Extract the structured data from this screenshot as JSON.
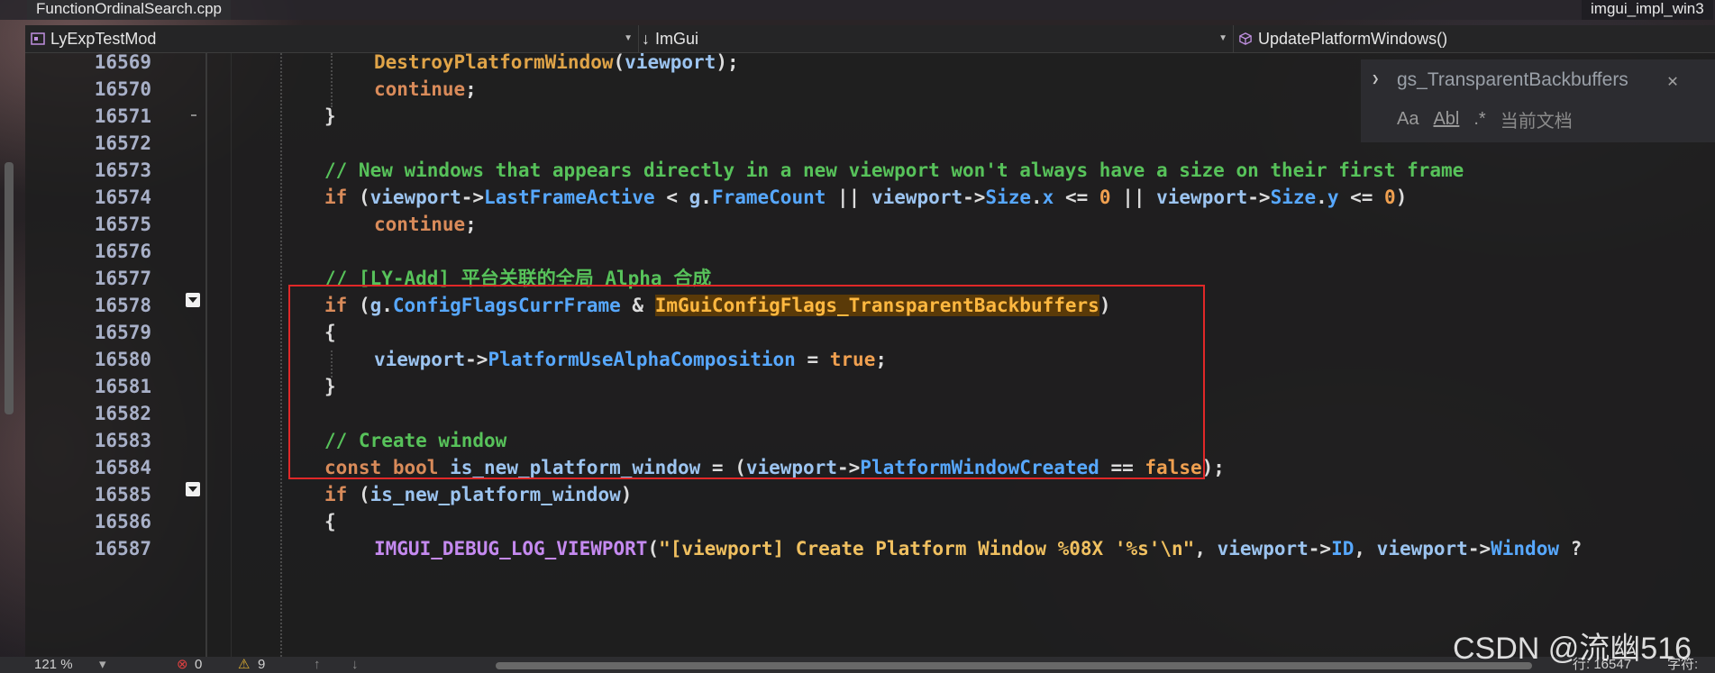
{
  "tabs": {
    "left_file": "FunctionOrdinalSearch.cpp",
    "right_file": "imgui_impl_win3"
  },
  "navbar": {
    "project": "LyExpTestMod",
    "scope": "ImGui",
    "member": "UpdatePlatformWindows()"
  },
  "find": {
    "query": "gs_TransparentBackbuffers",
    "opt_case": "Aa",
    "opt_word": "Abl",
    "opt_regex": ".*",
    "scope": "当前文档"
  },
  "code_lines": [
    {
      "num": "16569",
      "text": "DestroyPlatformWindow(viewport);"
    },
    {
      "num": "16570",
      "text": "continue;"
    },
    {
      "num": "16571",
      "text": "}"
    },
    {
      "num": "16572",
      "text": ""
    },
    {
      "num": "16573",
      "text": "// New windows that appears directly in a new viewport won't always have a size on their first frame"
    },
    {
      "num": "16574",
      "text": "if (viewport->LastFrameActive < g.FrameCount || viewport->Size.x <= 0 || viewport->Size.y <= 0)"
    },
    {
      "num": "16575",
      "text": "continue;"
    },
    {
      "num": "16576",
      "text": ""
    },
    {
      "num": "16577",
      "text": "// [LY-Add] 平台关联的全局 Alpha 合成"
    },
    {
      "num": "16578",
      "text": "if (g.ConfigFlagsCurrFrame & ImGuiConfigFlags_TransparentBackbuffers)"
    },
    {
      "num": "16579",
      "text": "{"
    },
    {
      "num": "16580",
      "text": "viewport->PlatformUseAlphaComposition = true;"
    },
    {
      "num": "16581",
      "text": "}"
    },
    {
      "num": "16582",
      "text": ""
    },
    {
      "num": "16583",
      "text": "// Create window"
    },
    {
      "num": "16584",
      "text": "const bool is_new_platform_window = (viewport->PlatformWindowCreated == false);"
    },
    {
      "num": "16585",
      "text": "if (is_new_platform_window)"
    },
    {
      "num": "16586",
      "text": "{"
    },
    {
      "num": "16587",
      "text": "IMGUI_DEBUG_LOG_VIEWPORT(\"[viewport] Create Platform Window %08X '%s'\\n\", viewport->ID, viewport->Window ?"
    }
  ],
  "status": {
    "zoom": "121 %",
    "errors": "0",
    "warnings": "9",
    "line": "行: 16547",
    "char": "字符:"
  },
  "watermark": "CSDN @流幽516"
}
